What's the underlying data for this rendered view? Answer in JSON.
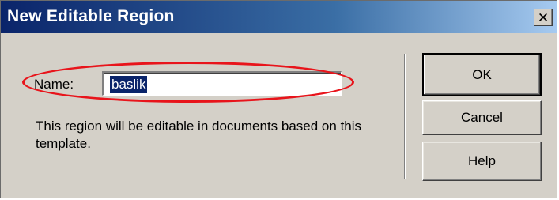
{
  "window": {
    "title": "New Editable Region",
    "close_glyph": "✕",
    "title_gradient": [
      "#0a246a",
      "#a6caf0"
    ]
  },
  "form": {
    "name_label": "Name:",
    "name_value": "baslik",
    "description": "This region will be editable in documents based on this template."
  },
  "buttons": {
    "ok": "OK",
    "cancel": "Cancel",
    "help": "Help"
  },
  "annotation": {
    "ring_color": "#e8141b"
  }
}
